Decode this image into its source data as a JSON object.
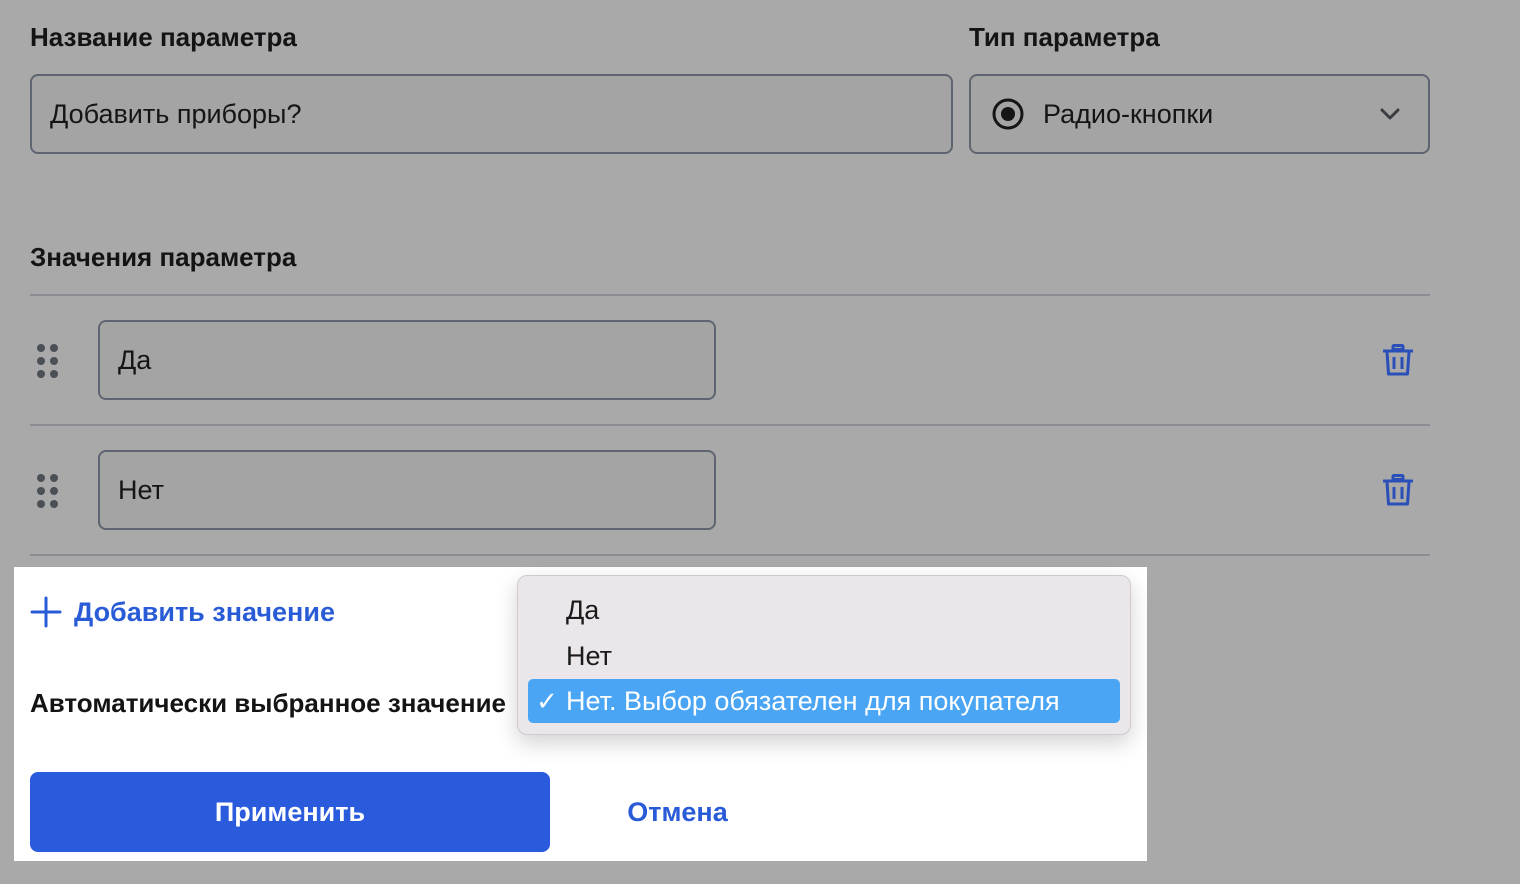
{
  "form": {
    "name_label": "Название параметра",
    "name_value": "Добавить приборы?",
    "type_label": "Тип параметра",
    "type_value": "Радио-кнопки",
    "values_label": "Значения параметра",
    "values": [
      {
        "value": "Да"
      },
      {
        "value": "Нет"
      }
    ]
  },
  "footer": {
    "add_value_label": "Добавить значение",
    "auto_value_label": "Автоматически выбранное значение",
    "apply_label": "Применить",
    "cancel_label": "Отмена"
  },
  "dropdown": {
    "options": [
      {
        "label": "Да",
        "selected": false
      },
      {
        "label": "Нет",
        "selected": false
      },
      {
        "label": "Нет. Выбор обязателен для покупателя",
        "selected": true
      }
    ],
    "check_mark": "✓"
  },
  "colors": {
    "accent": "#2a5bdc",
    "selection": "#4aa5f5",
    "overlay": "#a9a9a9"
  },
  "icons": {
    "radio": "radio-button-icon",
    "chevron": "chevron-down-icon",
    "drag": "drag-handle-icon",
    "delete": "trash-icon",
    "add": "plus-icon"
  }
}
